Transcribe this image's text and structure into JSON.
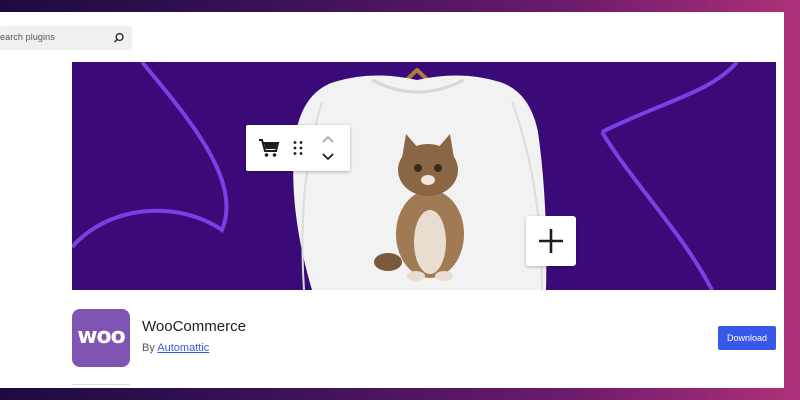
{
  "search": {
    "placeholder": "earch plugins",
    "icon": "search-icon"
  },
  "banner": {
    "background": "#3a0b78",
    "accent": "#7b3fe4",
    "image": "white sweatshirt with kitten print on hanger",
    "toolbar_icons": [
      "cart-icon",
      "drag-handle-icon",
      "chevron-up-icon",
      "chevron-down-icon"
    ],
    "add_icon": "plus-icon"
  },
  "plugin": {
    "logo_text": "woo",
    "logo_color": "#7f54b3",
    "name": "WooCommerce",
    "by_label": "By",
    "author": "Automattic",
    "download_label": "Download",
    "download_color": "#3858e9"
  }
}
